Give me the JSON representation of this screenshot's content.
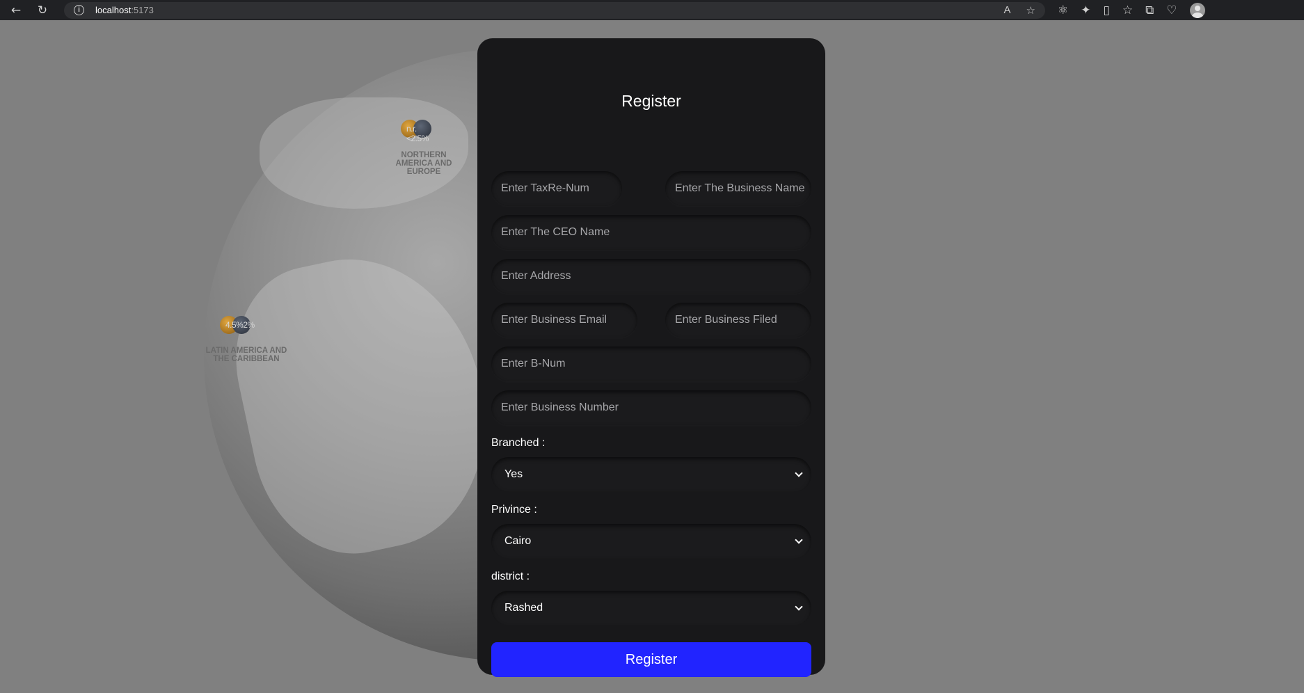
{
  "browser": {
    "url_host": "localhost",
    "url_port": ":5173"
  },
  "globe": {
    "regions": [
      {
        "label_lines": [
          "NORTHERN",
          "AMERICA AND",
          "EUROPE"
        ],
        "value_text": "n.r.<2.5%"
      },
      {
        "label_lines": [
          "LATIN AMERICA AND",
          "THE CARIBBEAN"
        ],
        "value_text": "4.5%2%"
      }
    ]
  },
  "form": {
    "title": "Register",
    "fields": {
      "tax_num": "Enter TaxRe-Num",
      "business_name": "Enter The Business Name",
      "ceo_name": "Enter The CEO Name",
      "address": "Enter Address",
      "business_email": "Enter Business Email",
      "business_field": "Enter Business Filed",
      "b_num": "Enter B-Num",
      "business_number": "Enter Business Number"
    },
    "branched": {
      "label": "Branched :",
      "value": "Yes"
    },
    "province": {
      "label": "Privince :",
      "value": "Cairo"
    },
    "district": {
      "label": "district :",
      "value": "Rashed"
    },
    "submit_label": "Register"
  },
  "colors": {
    "accent": "#2124ff",
    "panel_bg": "#18181a",
    "overlay_bg": "#808080"
  }
}
